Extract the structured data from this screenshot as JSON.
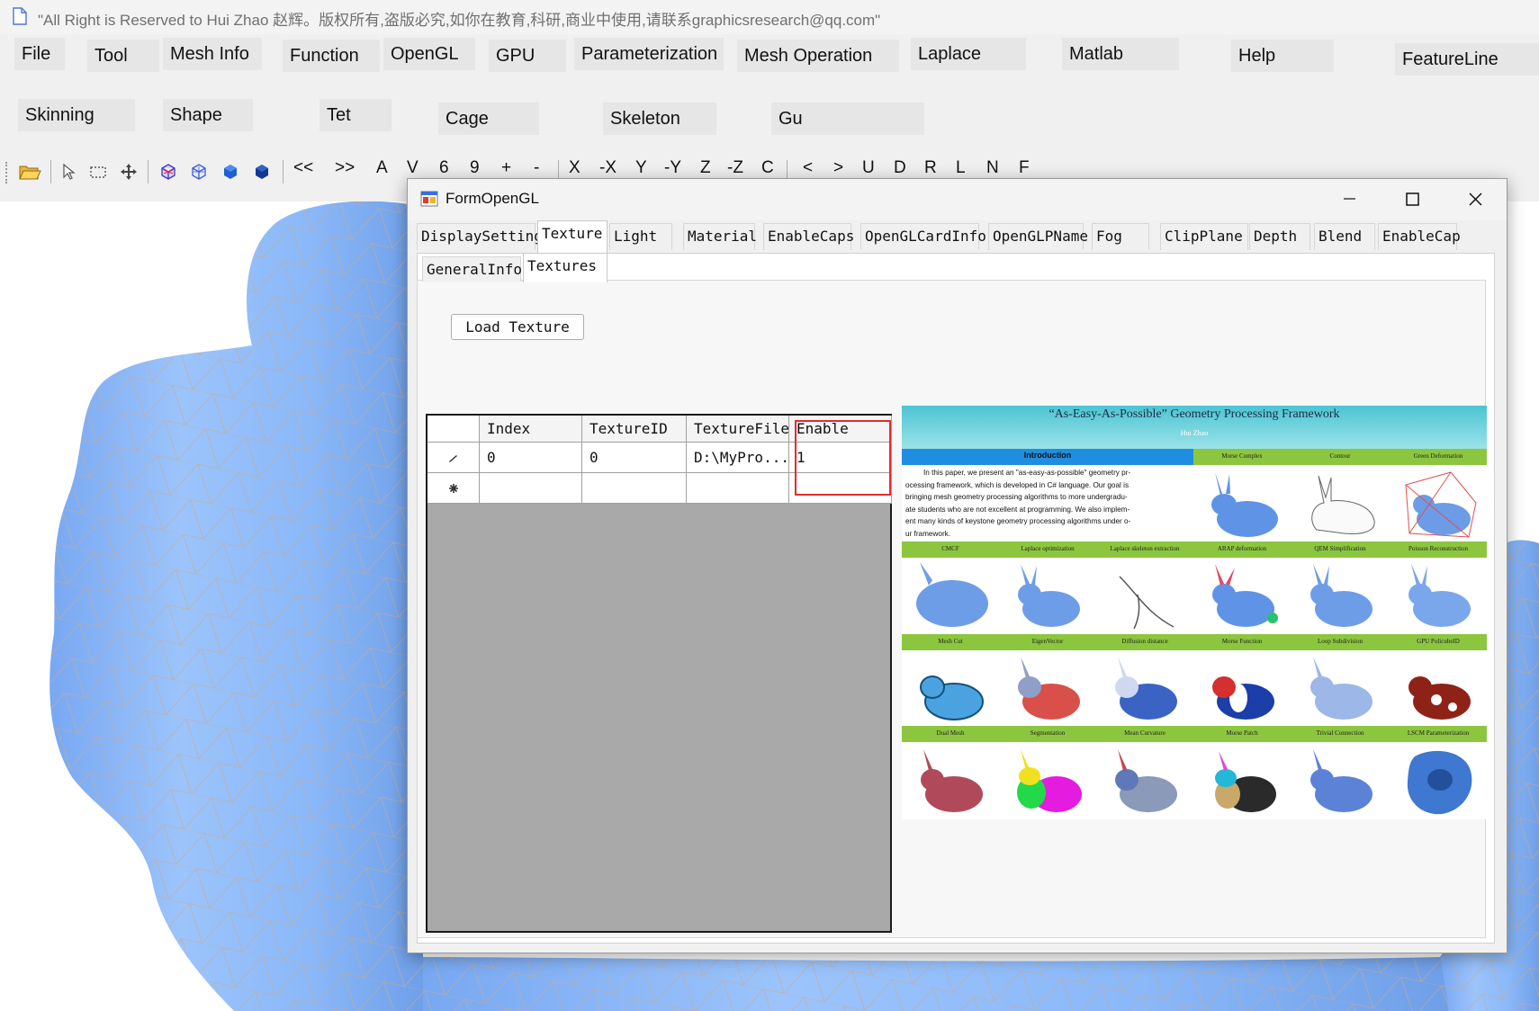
{
  "window": {
    "title": "\"All Right is Reserved to Hui Zhao 赵辉。版权所有,盗版必究,如你在教育,科研,商业中使用,请联系graphicsresearch@qq.com\""
  },
  "menu": {
    "row1": [
      "File",
      "Tool",
      "Mesh Info",
      "Function",
      "OpenGL",
      "GPU",
      "Parameterization",
      "Mesh Operation",
      "Laplace",
      "Matlab",
      "Help",
      "FeatureLine"
    ],
    "row2": [
      "Skinning",
      "Shape",
      "Tet",
      "Cage",
      "Skeleton",
      "Gu"
    ]
  },
  "toolbar": {
    "labels": [
      "<<",
      ">>",
      "A",
      "V",
      "6",
      "9",
      "+",
      "-",
      "X",
      "-X",
      "Y",
      "-Y",
      "Z",
      "-Z",
      "C",
      "<",
      ">",
      "U",
      "D",
      "R",
      "L",
      "N",
      "F"
    ],
    "icons": [
      "open-folder-icon",
      "pointer-select-icon",
      "rect-select-icon",
      "move-icon",
      "wire-cube-icon",
      "wire-cube-alt-icon",
      "solid-cube-icon",
      "solid-cube-dark-icon"
    ]
  },
  "dialog": {
    "title": "FormOpenGL",
    "tabs": [
      "DisplaySetting",
      "Texture",
      "Light",
      "Material",
      "EnableCaps",
      "OpenGLCardInfo",
      "OpenGLPName",
      "Fog",
      "ClipPlane",
      "Depth",
      "Blend",
      "EnableCap"
    ],
    "active_tab": "Texture",
    "subtabs": [
      "GeneralInfo",
      "Textures"
    ],
    "active_subtab": "Textures",
    "load_button": "Load Texture",
    "grid": {
      "columns": [
        "Index",
        "TextureID",
        "TextureFile",
        "Enable"
      ],
      "rows": [
        {
          "marker": "edit-pencil-icon",
          "cells": [
            "0",
            "0",
            "D:\\MyPro...",
            "1"
          ]
        },
        {
          "marker": "new-row-asterisk-icon",
          "cells": [
            "",
            "",
            "",
            ""
          ]
        }
      ]
    }
  },
  "poster": {
    "title": "“As-Easy-As-Possible”  Geometry Processing Framework",
    "author": "Hui Zhao",
    "intro_heading": "Introduction",
    "intro_text": [
      "In this paper, we present an \"as-easy-as-possible\" geometry pr-",
      "ocessing framework, which is developed in C# language. Our goal is",
      "bringing mesh geometry processing algorithms to more undergradu-",
      "ate students who are not excellent at programming. We also implem-",
      "ent many kinds of keystone geometry processing algorithms under o-",
      "ur framework."
    ],
    "row0_labels": [
      "Morse Complex",
      "Contour",
      "Green Deformation"
    ],
    "row1_labels": [
      "CMCF",
      "Laplace optimization",
      "Laplace skeleton extraction",
      "ARAP deformation",
      "QEM Simplification",
      "Poisson Reconstruction"
    ],
    "row2_labels": [
      "Mesh Cut",
      "EigenVector",
      "Diffusion distance",
      "Morse Function",
      "Loop Subdivision",
      "GPU PolicubeID"
    ],
    "row3_labels": [
      "Dual Mesh",
      "Segmentation",
      "Mean Curvature",
      "Morse Patch",
      "Trivial Connection",
      "LSCM Parameterization"
    ],
    "thumb_styles": [
      "blue-bunny",
      "outline-bunny",
      "cage-bunny",
      "blue-bunny",
      "blue-bunny",
      "skeleton",
      "blue-bunny",
      "blue-bunny",
      "blue-bunny",
      "wire-bunny",
      "red-blue-bunny",
      "blue-white-bunny",
      "red-white-blue-bunny",
      "pale-bunny",
      "red-spots-bunny",
      "dotted-red-bunny",
      "segmented-bunny",
      "curvature-bunny",
      "patch-bunny",
      "dotted-blue-bunny",
      "flat-param"
    ]
  },
  "colors": {
    "mesh_blue": "#8ab8f8",
    "poster_header": "#60cdd6",
    "poster_green": "#8cc63f",
    "intro_blue": "#1f8ee0",
    "highlight_red": "#e52b2b"
  }
}
